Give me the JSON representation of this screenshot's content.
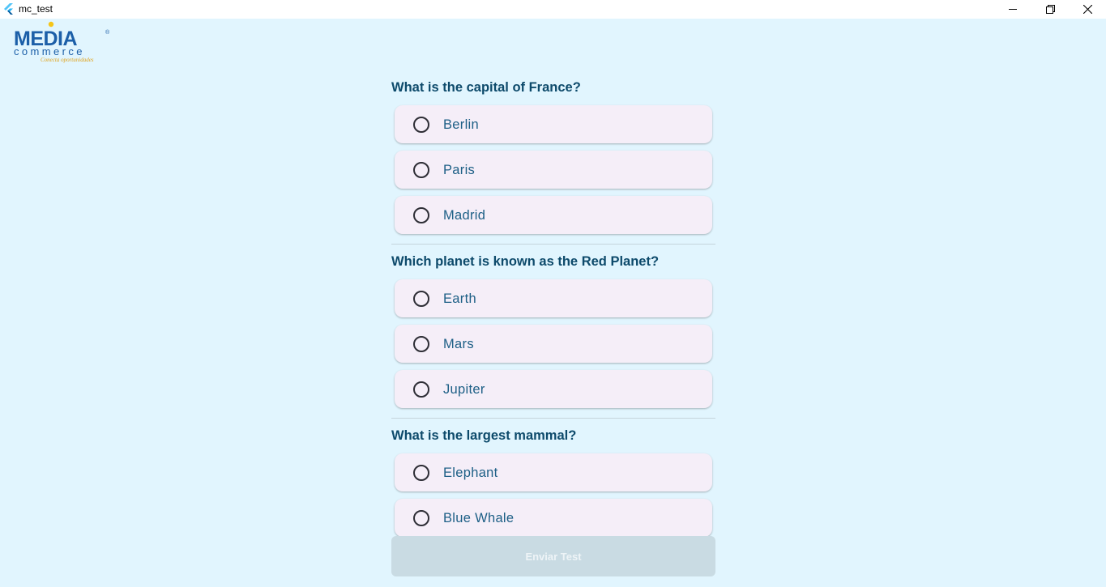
{
  "window": {
    "title": "mc_test",
    "icons": {
      "app": "flutter-logo-icon",
      "minimize": "minimize-icon",
      "maximize": "restore-icon",
      "close": "close-icon"
    }
  },
  "logo": {
    "brand": "MEDIA",
    "sub": "commerce",
    "tagline": "Conecta oportunidades",
    "colors": {
      "blue": "#1c5fa8",
      "yellow": "#f5c518"
    }
  },
  "questions": [
    {
      "text": "What is the capital of France?",
      "options": [
        "Berlin",
        "Paris",
        "Madrid"
      ]
    },
    {
      "text": "Which planet is known as the Red Planet?",
      "options": [
        "Earth",
        "Mars",
        "Jupiter"
      ]
    },
    {
      "text": "What is the largest mammal?",
      "options": [
        "Elephant",
        "Blue Whale"
      ]
    }
  ],
  "submit_label": "Enviar Test",
  "colors": {
    "background": "#e1f5fe",
    "question": "#0d4a6b",
    "option_bg": "#f5eef8",
    "option_text": "#1d5f86",
    "button_disabled": "#c9dbe3"
  }
}
